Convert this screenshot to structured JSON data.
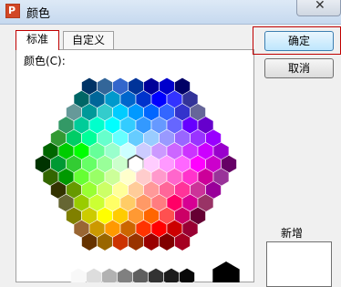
{
  "window": {
    "title": "颜色"
  },
  "tabs": [
    {
      "label": "标准",
      "active": true
    },
    {
      "label": "自定义",
      "active": false
    }
  ],
  "colors_label": "颜色(C):",
  "buttons": {
    "ok": "确定",
    "cancel": "取消"
  },
  "new_label": "新增",
  "selected_color": "#ffffff",
  "accent_colors": {
    "highlight_box": "#c00000",
    "ok_button": "#3c7fb1"
  },
  "hex_palette_rows": [
    [
      "#003366",
      "#336699",
      "#3366cc",
      "#003399",
      "#000099",
      "#0000cc",
      "#000066"
    ],
    [
      "#006666",
      "#006699",
      "#0099cc",
      "#0066cc",
      "#0033cc",
      "#0000ff",
      "#3333ff",
      "#333399"
    ],
    [
      "#669999",
      "#009999",
      "#33cccc",
      "#00ccff",
      "#0099ff",
      "#0066ff",
      "#3366ff",
      "#3333cc",
      "#666699"
    ],
    [
      "#339966",
      "#00cc99",
      "#00ffcc",
      "#00ffff",
      "#33ccff",
      "#3399ff",
      "#6699ff",
      "#6666ff",
      "#6600ff",
      "#6600cc"
    ],
    [
      "#339933",
      "#00cc66",
      "#00ff99",
      "#66ffcc",
      "#66ffff",
      "#66ccff",
      "#99ccff",
      "#9999ff",
      "#9966ff",
      "#9933ff",
      "#9900ff"
    ],
    [
      "#006600",
      "#00cc00",
      "#00ff00",
      "#66ff99",
      "#99ffcc",
      "#ccffff",
      "#ccccff",
      "#cc99ff",
      "#cc66ff",
      "#cc33ff",
      "#cc00ff",
      "#9900cc"
    ],
    [
      "#003300",
      "#009933",
      "#33cc33",
      "#66ff66",
      "#99ff99",
      "#ccffcc",
      "#ffffff",
      "#ffccff",
      "#ff99ff",
      "#ff66ff",
      "#ff00ff",
      "#cc00cc",
      "#660066"
    ],
    [
      "#336600",
      "#009900",
      "#66ff33",
      "#99ff66",
      "#ccff99",
      "#ffffcc",
      "#ffcccc",
      "#ff99cc",
      "#ff66cc",
      "#ff33cc",
      "#cc0099",
      "#993399"
    ],
    [
      "#333300",
      "#669900",
      "#99ff33",
      "#ccff66",
      "#ffff99",
      "#ffcc99",
      "#ff9999",
      "#ff6699",
      "#ff3399",
      "#cc3399",
      "#990099"
    ],
    [
      "#666633",
      "#99cc00",
      "#ccff33",
      "#ffff66",
      "#ffcc66",
      "#ff9966",
      "#ff7c80",
      "#ff0066",
      "#d60093",
      "#993366"
    ],
    [
      "#808000",
      "#cccc00",
      "#ffff00",
      "#ffcc00",
      "#ff9933",
      "#ff6600",
      "#ff5050",
      "#cc0066",
      "#660033"
    ],
    [
      "#996633",
      "#cc9900",
      "#ff9900",
      "#cc6600",
      "#ff3300",
      "#ff0000",
      "#cc0000",
      "#990033"
    ],
    [
      "#663300",
      "#996600",
      "#cc3300",
      "#993300",
      "#990000",
      "#800000",
      "#a50021"
    ]
  ],
  "gray_row": [
    "#f8f8f8",
    "#dddddd",
    "#b2b2b2",
    "#808080",
    "#5f5f5f",
    "#333333",
    "#1c1c1c",
    "#080808"
  ],
  "black_swatch": "#000000"
}
